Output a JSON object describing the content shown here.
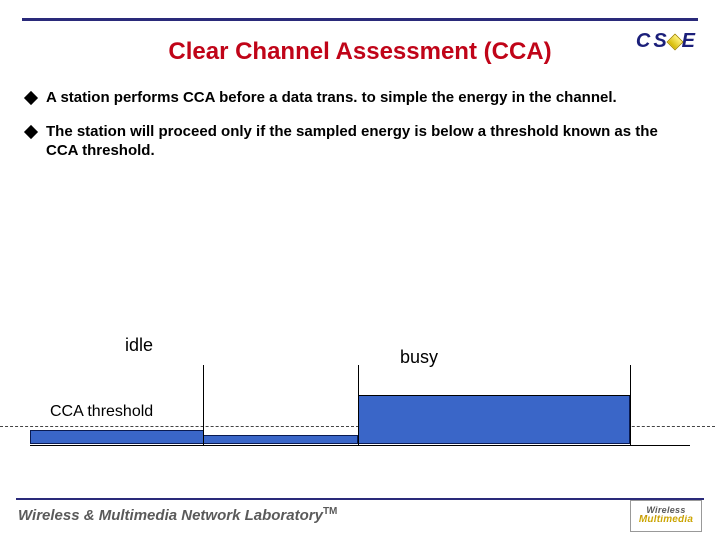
{
  "logo": {
    "c": "C",
    "s": "S",
    "e": "E"
  },
  "title": "Clear Channel Assessment (CCA)",
  "bullets": [
    "A station performs CCA before a data trans. to simple the energy in the channel.",
    "The station will proceed only if the sampled energy is below a threshold known as the\nCCA threshold."
  ],
  "diagram": {
    "idle": "idle",
    "busy": "busy",
    "threshold": "CCA threshold"
  },
  "footer": {
    "lab": "Wireless & Multimedia Network Laboratory",
    "tm": "TM",
    "logo_top": "Wireless",
    "logo_bottom": "Multimedia"
  }
}
